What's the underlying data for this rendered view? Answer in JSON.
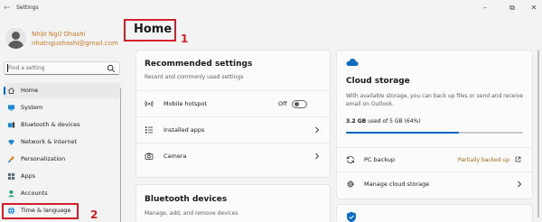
{
  "window": {
    "title": "Settings",
    "back_glyph": "←",
    "minimize_glyph": "–",
    "restore_glyph": "⧉",
    "close_glyph": "✕"
  },
  "user": {
    "name": "Nhật Ngữ Ohashi",
    "email": "nhatnguohashi@gmail.com"
  },
  "search": {
    "placeholder": "Find a setting",
    "icon": "search-icon"
  },
  "sidebar": {
    "items": [
      {
        "label": "Home",
        "icon": "home-icon",
        "active": true
      },
      {
        "label": "System",
        "icon": "monitor-icon"
      },
      {
        "label": "Bluetooth & devices",
        "icon": "bluetooth-devices-icon"
      },
      {
        "label": "Network & internet",
        "icon": "network-icon"
      },
      {
        "label": "Personalization",
        "icon": "brush-icon"
      },
      {
        "label": "Apps",
        "icon": "apps-icon"
      },
      {
        "label": "Accounts",
        "icon": "person-icon"
      },
      {
        "label": "Time & language",
        "icon": "globe-clock-icon"
      }
    ]
  },
  "annotations": [
    {
      "number": "1",
      "color": "#d21f2b"
    },
    {
      "number": "2",
      "color": "#d21f2b"
    }
  ],
  "main": {
    "title": "Home",
    "recommended": {
      "title": "Recommended settings",
      "subtitle": "Recent and commonly used settings",
      "rows": [
        {
          "label": "Mobile hotspot",
          "icon": "hotspot-icon",
          "toggle_text": "Off",
          "toggle_on": false
        },
        {
          "label": "Installed apps",
          "icon": "list-icon"
        },
        {
          "label": "Camera",
          "icon": "camera-icon"
        }
      ]
    },
    "bluetooth": {
      "title": "Bluetooth devices",
      "subtitle": "Manage, add, and remove devices"
    },
    "cloud": {
      "icon": "cloud-icon",
      "title": "Cloud storage",
      "description": "With available storage, you can back up files or send and receive email on Outlook.",
      "used": "3.2 GB",
      "usage_rest": "used of 5 GB (64%)",
      "percent": 0.64,
      "rows": [
        {
          "label": "PC backup",
          "icon": "sync-icon",
          "status": "Partially backed up"
        },
        {
          "label": "Manage cloud storage",
          "icon": "gear-icon"
        }
      ]
    },
    "security": {
      "icon": "shield-check-icon"
    }
  },
  "colors": {
    "accent": "#0067c0",
    "annotation": "#d21f2b",
    "user_text": "#c97a2a",
    "status_warning": "#9a6b1a"
  }
}
